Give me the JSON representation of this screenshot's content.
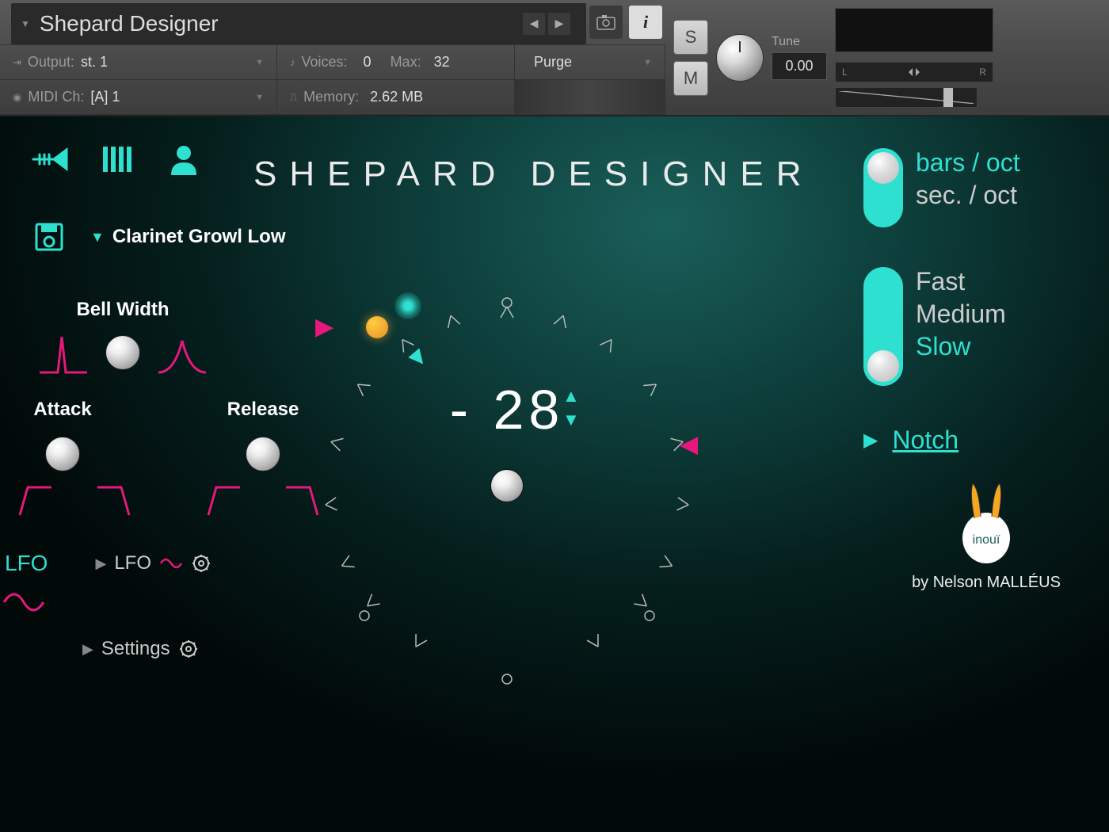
{
  "header": {
    "instrument_title": "Shepard Designer",
    "output_label": "Output:",
    "output_value": "st. 1",
    "midi_label": "MIDI Ch:",
    "midi_value": "[A] 1",
    "voices_label": "Voices:",
    "voices_value": "0",
    "max_label": "Max:",
    "max_value": "32",
    "memory_label": "Memory:",
    "memory_value": "2.62 MB",
    "purge_label": "Purge",
    "solo_label": "S",
    "mute_label": "M",
    "tune_label": "Tune",
    "tune_value": "0.00",
    "pan_left": "L",
    "pan_right": "R"
  },
  "main": {
    "title": "SHEPARD DESIGNER",
    "preset_name": "Clarinet Growl Low",
    "bell_width_label": "Bell Width",
    "attack_label": "Attack",
    "release_label": "Release",
    "lfo_main": "LFO",
    "lfo_sub": "LFO",
    "settings_label": "Settings",
    "dial_value": "- 28",
    "notch_label": "Notch",
    "credit": "by Nelson MALLÉUS",
    "brand": "inouï"
  },
  "toggles": {
    "rate_unit": {
      "opt1": "bars / oct",
      "opt2": "sec. / oct",
      "active": 0
    },
    "speed": {
      "opt1": "Fast",
      "opt2": "Medium",
      "opt3": "Slow",
      "active": 2
    }
  },
  "colors": {
    "teal": "#2de0d0",
    "pink": "#e6177d",
    "orange": "#f5a623"
  }
}
